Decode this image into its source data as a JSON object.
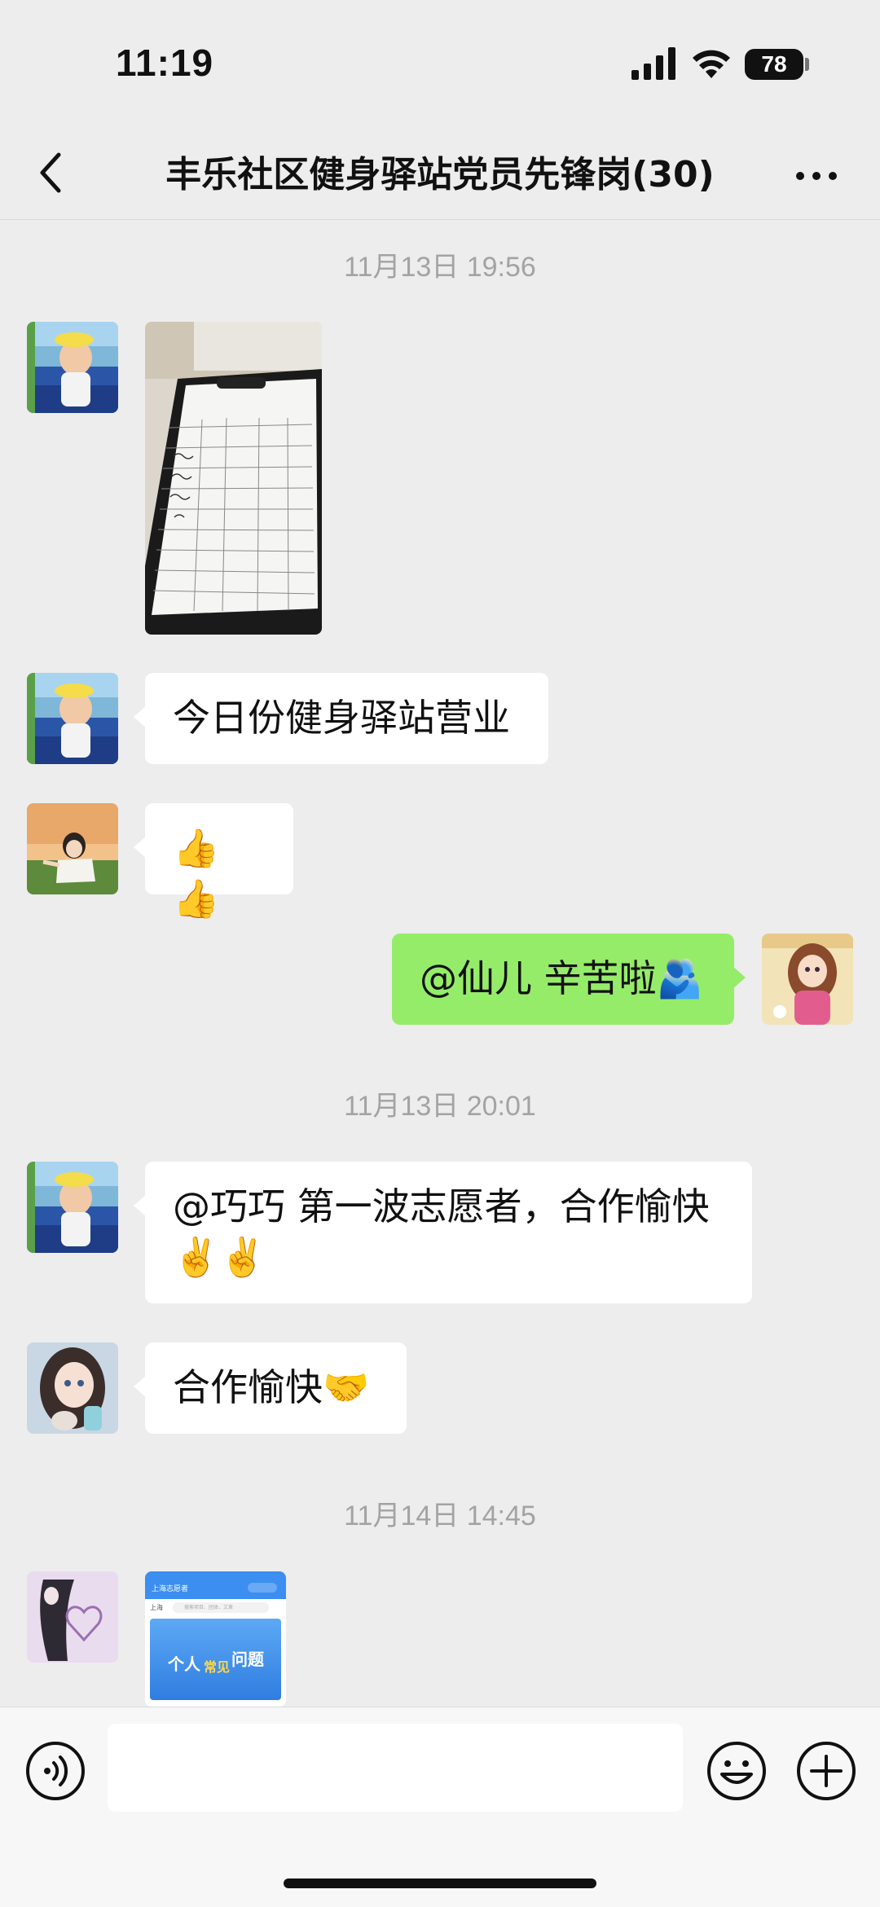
{
  "status_bar": {
    "time": "11:19",
    "battery": "78"
  },
  "header": {
    "title": "丰乐社区健身驿站党员先锋岗(30)"
  },
  "messages": {
    "ts1": "11月13日 19:56",
    "m2_text": "今日份健身驿站营业",
    "m3_text": "👍👍",
    "m4_text": "@仙儿 辛苦啦🫂",
    "ts2": "11月13日 20:01",
    "m5_line1": "@巧巧 第一波志愿者，合作愉快",
    "m5_line2": "✌️✌️",
    "m6_text": "合作愉快🤝",
    "ts3": "11月14日 14:45"
  },
  "thumbnail": {
    "app_title": "上海志愿者",
    "region": "上海",
    "search_placeholder": "搜索项目、团体、文章",
    "banner_a": "个人",
    "banner_b": "常见",
    "banner_c": "问题"
  }
}
